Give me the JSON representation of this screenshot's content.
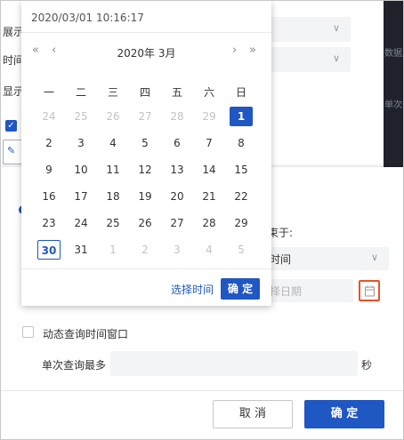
{
  "background": {
    "labels": [
      "展示",
      "时间",
      "显示"
    ],
    "strip_texts": [
      "数据此连",
      "单次查询"
    ],
    "check_icon": "checkmark-icon",
    "box_icon": "brush-icon"
  },
  "dialog": {
    "end_label": "束于:",
    "end_select_value": "时间",
    "date_placeholder": "择日期",
    "calendar_icon": "calendar-icon",
    "dynamic_checkbox_label": "动态查询时间窗口",
    "single_query_label": "单次查询最多",
    "seconds_unit": "秒",
    "cancel_label": "取 消",
    "ok_label": "确 定"
  },
  "calendar": {
    "header_datetime": "2020/03/01 10:16:17",
    "month_title": "2020年 3月",
    "nav": {
      "prev_year": "«",
      "prev_month": "‹",
      "next_month": "›",
      "next_year": "»"
    },
    "weekdays": [
      "一",
      "二",
      "三",
      "四",
      "五",
      "六",
      "日"
    ],
    "weeks": [
      [
        {
          "d": "24",
          "m": 1
        },
        {
          "d": "25",
          "m": 1
        },
        {
          "d": "26",
          "m": 1
        },
        {
          "d": "27",
          "m": 1
        },
        {
          "d": "28",
          "m": 1
        },
        {
          "d": "29",
          "m": 1
        },
        {
          "d": "1",
          "s": 1
        }
      ],
      [
        {
          "d": "2"
        },
        {
          "d": "3"
        },
        {
          "d": "4"
        },
        {
          "d": "5"
        },
        {
          "d": "6"
        },
        {
          "d": "7"
        },
        {
          "d": "8"
        }
      ],
      [
        {
          "d": "9"
        },
        {
          "d": "10"
        },
        {
          "d": "11"
        },
        {
          "d": "12"
        },
        {
          "d": "13"
        },
        {
          "d": "14"
        },
        {
          "d": "15"
        }
      ],
      [
        {
          "d": "16"
        },
        {
          "d": "17"
        },
        {
          "d": "18"
        },
        {
          "d": "19"
        },
        {
          "d": "20"
        },
        {
          "d": "21"
        },
        {
          "d": "22"
        }
      ],
      [
        {
          "d": "23"
        },
        {
          "d": "24"
        },
        {
          "d": "25"
        },
        {
          "d": "26"
        },
        {
          "d": "27"
        },
        {
          "d": "28"
        },
        {
          "d": "29"
        }
      ],
      [
        {
          "d": "30",
          "t": 1
        },
        {
          "d": "31"
        },
        {
          "d": "1",
          "m": 1
        },
        {
          "d": "2",
          "m": 1
        },
        {
          "d": "3",
          "m": 1
        },
        {
          "d": "4",
          "m": 1
        },
        {
          "d": "5",
          "m": 1
        }
      ]
    ],
    "select_time_label": "选择时间",
    "confirm_label": "确 定"
  }
}
